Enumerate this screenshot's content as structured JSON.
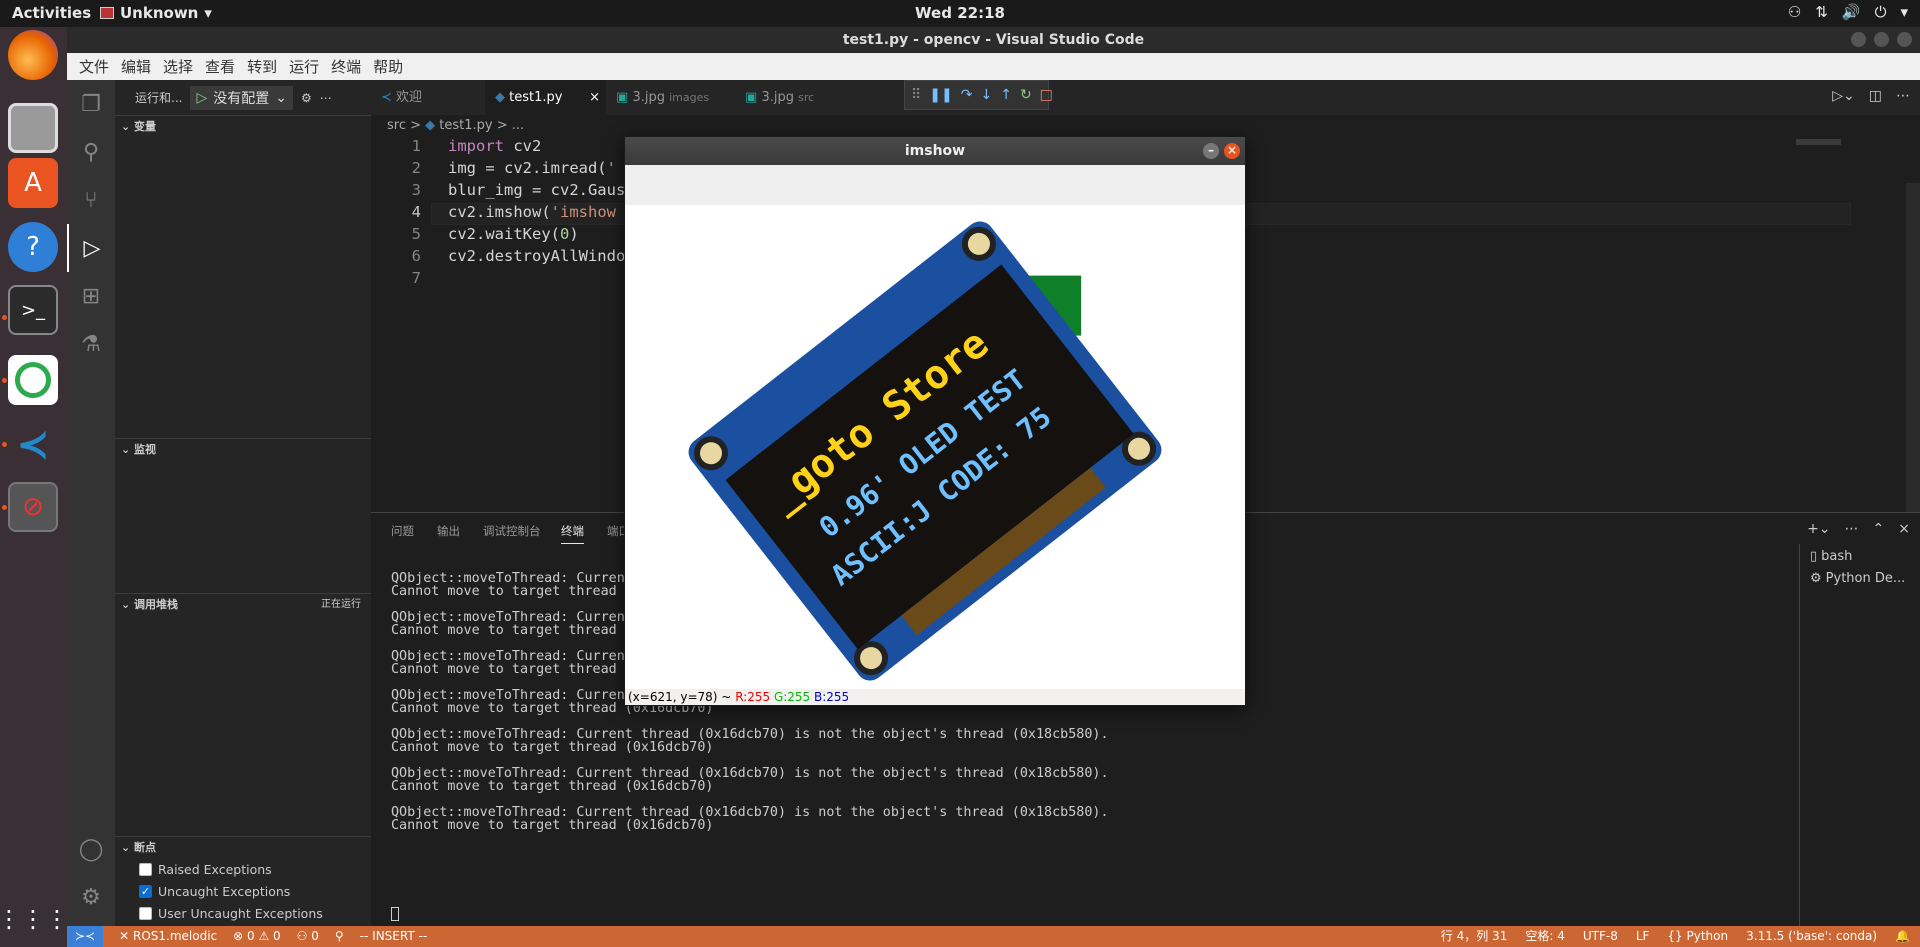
{
  "topbar": {
    "activities": "Activities",
    "app_name": "Unknown",
    "clock": "Wed 22:18"
  },
  "window": {
    "title": "test1.py - opencv - Visual Studio Code"
  },
  "menu": [
    "文件",
    "编辑",
    "选择",
    "查看",
    "转到",
    "运行",
    "终端",
    "帮助"
  ],
  "sidebar": {
    "run_label": "运行和...",
    "config": "没有配置",
    "variables": "变量",
    "watch": "监视",
    "callstack": "调用堆栈",
    "callstack_status": "正在运行",
    "breakpoints": "断点",
    "bp_items": [
      {
        "label": "Raised Exceptions",
        "checked": false
      },
      {
        "label": "Uncaught Exceptions",
        "checked": true
      },
      {
        "label": "User Uncaught Exceptions",
        "checked": false
      }
    ]
  },
  "tabs": [
    {
      "label": "欢迎",
      "sub": ""
    },
    {
      "label": "test1.py",
      "sub": ""
    },
    {
      "label": "3.jpg",
      "sub": "images"
    },
    {
      "label": "3.jpg",
      "sub": "src"
    }
  ],
  "breadcrumb": {
    "folder": "src",
    "file": "test1.py",
    "more": "..."
  },
  "code": [
    {
      "n": "1",
      "text": "import cv2"
    },
    {
      "n": "2",
      "text": "img = cv2.imread('"
    },
    {
      "n": "3",
      "text": "blur_img = cv2.Gaus"
    },
    {
      "n": "4",
      "text": "cv2.imshow('imshow"
    },
    {
      "n": "5",
      "text": "cv2.waitKey(0)"
    },
    {
      "n": "6",
      "text": "cv2.destroyAllWindo"
    },
    {
      "n": "7",
      "text": ""
    }
  ],
  "panel": {
    "tabs": [
      "问题",
      "输出",
      "调试控制台",
      "终端",
      "端口"
    ],
    "terminal_lines": [
      "QObject::moveToThread: Curren",
      "Cannot move to target thread",
      "",
      "QObject::moveToThread: Curren",
      "Cannot move to target thread",
      "",
      "QObject::moveToThread: Curren",
      "Cannot move to target thread",
      "",
      "QObject::moveToThread: Current thread (0x16dcb70) is not the object's thread (0x18cb580).",
      "Cannot move to target thread (0x16dcb70)",
      "",
      "QObject::moveToThread: Current thread (0x16dcb70) is not the object's thread (0x18cb580).",
      "Cannot move to target thread (0x16dcb70)",
      "",
      "QObject::moveToThread: Current thread (0x16dcb70) is not the object's thread (0x18cb580).",
      "Cannot move to target thread (0x16dcb70)",
      "",
      "QObject::moveToThread: Current thread (0x16dcb70) is not the object's thread (0x18cb580).",
      "Cannot move to target thread (0x16dcb70)"
    ],
    "terminals": [
      "bash",
      "Python De..."
    ]
  },
  "statusbar": {
    "remote": "ROS1.melodic",
    "problems": "0 ⚠ 0",
    "ports": "0",
    "mode": "-- INSERT --",
    "position": "行 4，列 31",
    "spaces": "空格: 4",
    "encoding": "UTF-8",
    "eol": "LF",
    "language": "Python",
    "interpreter": "3.11.5 ('base': conda)"
  },
  "imshow": {
    "title": "imshow",
    "status_coord": "(x=621, y=78) ~",
    "r": "R:255",
    "g": "G:255",
    "b": "B:255",
    "image_text": [
      "_goto Store",
      "0.96' OLED TEST",
      "ASCII:J CODE: 75"
    ]
  },
  "colors": {
    "statusbar": "#cc6633",
    "accent": "#e95420"
  }
}
